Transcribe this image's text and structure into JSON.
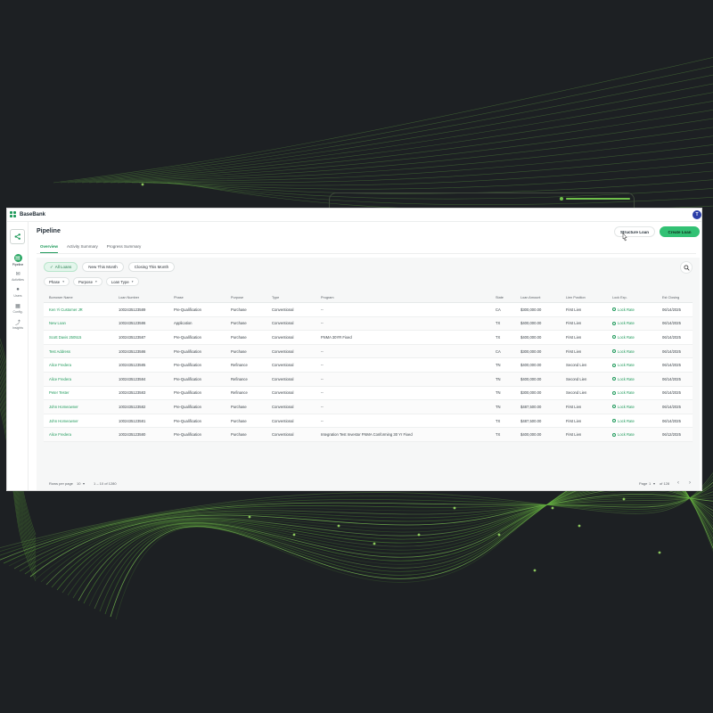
{
  "colors": {
    "background": "#1d2023",
    "accent": "#1f9a5b",
    "primary_button": "#32c174",
    "avatar": "#2c3fa8"
  },
  "brand": {
    "name": "BaseBank"
  },
  "user": {
    "initial": "T"
  },
  "sidebar": {
    "toggle_icon": "share-nodes-icon",
    "items": [
      {
        "label": "Pipeline",
        "icon": "document-icon",
        "active": true
      },
      {
        "label": "Activities",
        "icon": "mail-icon",
        "active": false
      },
      {
        "label": "Users",
        "icon": "user-icon",
        "active": false
      },
      {
        "label": "Config.",
        "icon": "grid-icon",
        "active": false
      },
      {
        "label": "Insights",
        "icon": "chart-icon",
        "active": false
      }
    ]
  },
  "header": {
    "title": "Pipeline",
    "structure_button": "Structure Loan",
    "create_button": "Create Loan"
  },
  "tabs": [
    {
      "label": "Overview",
      "active": true
    },
    {
      "label": "Activity Summary",
      "active": false
    },
    {
      "label": "Progress Summary",
      "active": false
    }
  ],
  "filter_chips": [
    {
      "label": "All Loans",
      "active": true
    },
    {
      "label": "New This Month",
      "active": false
    },
    {
      "label": "Closing This Month",
      "active": false
    }
  ],
  "dropdowns": [
    "Phase",
    "Purpose",
    "Loan Type"
  ],
  "table": {
    "columns": [
      "Borrower Name",
      "Loan Number",
      "Phase",
      "Purpose",
      "Type",
      "Program",
      "State",
      "Loan Amount",
      "Lien Position",
      "Lock Exp.",
      "Est Closing"
    ],
    "rows": [
      [
        "Ken Yi Customer JR",
        "1002435123589",
        "Pre-Qualification",
        "Purchase",
        "Conventional",
        "--",
        "CA",
        "$300,000.00",
        "First Lien",
        "Lock Rate",
        "06/14/2025"
      ],
      [
        "New Loan",
        "1002435123586",
        "Application",
        "Purchase",
        "Conventional",
        "--",
        "TX",
        "$400,000.00",
        "First Lien",
        "Lock Rate",
        "06/14/2025"
      ],
      [
        "Scott Davis 250515",
        "1002435123587",
        "Pre-Qualification",
        "Purchase",
        "Conventional",
        "FNMA 30YR Fixed",
        "TX",
        "$400,000.00",
        "First Lien",
        "Lock Rate",
        "06/14/2025"
      ],
      [
        "Test Address",
        "1002435123586",
        "Pre-Qualification",
        "Purchase",
        "Conventional",
        "--",
        "CA",
        "$300,000.00",
        "First Lien",
        "Lock Rate",
        "06/14/2025"
      ],
      [
        "Alice Fredera",
        "1002435123585",
        "Pre-Qualification",
        "Refinance",
        "Conventional",
        "--",
        "TN",
        "$400,000.00",
        "Second Lien",
        "Lock Rate",
        "06/14/2025"
      ],
      [
        "Alice Fredera",
        "1002435123584",
        "Pre-Qualification",
        "Refinance",
        "Conventional",
        "--",
        "TN",
        "$400,000.00",
        "Second Lien",
        "Lock Rate",
        "06/14/2025"
      ],
      [
        "Peter Tester",
        "1002435123583",
        "Pre-Qualification",
        "Refinance",
        "Conventional",
        "--",
        "TN",
        "$300,000.00",
        "Second Lien",
        "Lock Rate",
        "06/14/2025"
      ],
      [
        "John Homeowner",
        "1002435123582",
        "Pre-Qualification",
        "Purchase",
        "Conventional",
        "--",
        "TN",
        "$487,500.00",
        "First Lien",
        "Lock Rate",
        "06/14/2025"
      ],
      [
        "John Homeowner",
        "1002435123581",
        "Pre-Qualification",
        "Purchase",
        "Conventional",
        "--",
        "TX",
        "$487,500.00",
        "First Lien",
        "Lock Rate",
        "06/14/2025"
      ],
      [
        "Alice Fredera",
        "1002435123580",
        "Pre-Qualification",
        "Purchase",
        "Conventional",
        "Integration Test Investor FNMA Conforming 30 Yr Fixed",
        "TX",
        "$400,000.00",
        "First Lien",
        "Lock Rate",
        "06/12/2025"
      ]
    ]
  },
  "footer": {
    "rows_per_page_label": "Rows per page",
    "rows_per_page_value": "10",
    "range": "1 – 10 of 1280",
    "page_label": "Page",
    "page_value": "1",
    "page_total": "of 128"
  }
}
